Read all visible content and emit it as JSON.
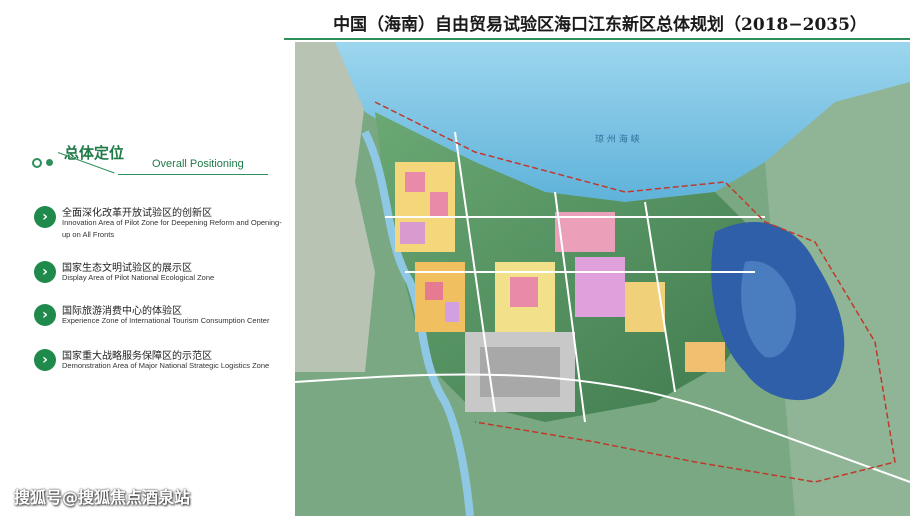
{
  "title": "中国（海南）自由贸易试验区海口江东新区总体规划（2018−2035）",
  "section": {
    "title_zh": "总体定位",
    "title_en": "Overall Positioning"
  },
  "items": [
    {
      "zh": "全面深化改革开放试验区的创新区",
      "en": "Innovation Area of Pilot Zone for Deepening Reform and Opening-up on All Fronts"
    },
    {
      "zh": "国家生态文明试验区的展示区",
      "en": "Display Area of Pilot National Ecological Zone"
    },
    {
      "zh": "国际旅游消费中心的体验区",
      "en": "Experience Zone of International Tourism Consumption Center"
    },
    {
      "zh": "国家重大战略服务保障区的示范区",
      "en": "Demonstration Area of Major National Strategic Logistics Zone"
    }
  ],
  "map": {
    "sea_label": "琼 州 海 峡"
  },
  "watermark": "搜狐号@搜狐焦点酒泉站",
  "colors": {
    "accent": "#1f8a4c",
    "sea": "#7fc3e3",
    "green": "#4f8a5a",
    "lake": "#2f5fa8"
  }
}
